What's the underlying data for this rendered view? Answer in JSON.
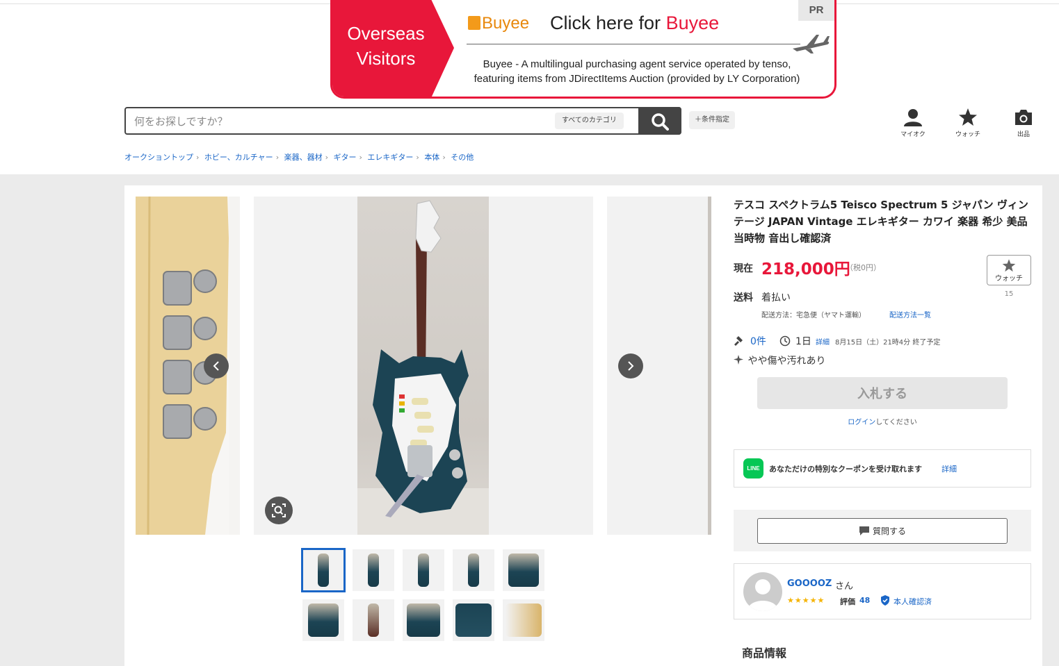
{
  "banner": {
    "left_line1": "Overseas",
    "left_line2": "Visitors",
    "pr": "PR",
    "logo": "Buyee",
    "headline_prefix": "Click here for ",
    "headline_brand": "Buyee",
    "desc_line1": "Buyee - A multilingual purchasing agent service operated by tenso,",
    "desc_line2": "featuring items from JDirectItems Auction (provided by LY Corporation)",
    "accent_color": "#e8173a"
  },
  "search": {
    "placeholder": "何をお探しですか？",
    "category": "すべてのカテゴリ",
    "conditions": "＋条件指定"
  },
  "header_nav": {
    "myauction": "マイオク",
    "watch": "ウォッチ",
    "sell": "出品"
  },
  "breadcrumb": [
    "オークショントップ",
    "ホビー、カルチャー",
    "楽器、器材",
    "ギター",
    "エレキギター",
    "本体",
    "その他"
  ],
  "item": {
    "title": "テスコ スペクトラム5 Teisco Spectrum 5 ジャパン ヴィンテージ JAPAN Vintage エレキギター カワイ 楽器 希少 美品 当時物 音出し確認済",
    "price_label": "現在",
    "price": "218,000円",
    "tax": "（税0円）",
    "watch_label": "ウォッチ",
    "watch_count": "15",
    "shipping_label": "送料",
    "shipping_value": "着払い",
    "shipping_method": "配送方法：宅急便（ヤマト運輸）",
    "shipping_link": "配送方法一覧",
    "bid_count": "0件",
    "time_left": "1日",
    "detail_link": "詳細",
    "end_time": "8月15日（土）21時4分 終了予定",
    "condition": "やや傷や汚れあり",
    "bid_button": "入札する",
    "login_link": "ログイン",
    "login_suffix": "してください"
  },
  "coupon": {
    "icon_text": "LINE",
    "text": "あなただけの特別なクーポンを受け取れます",
    "link": "詳細"
  },
  "question_button": "質問する",
  "seller": {
    "name": "GOOOOZ",
    "suffix": "さん",
    "stars": "★★★★★",
    "rating_label": "評価",
    "rating": "48",
    "verified": "本人確認済"
  },
  "section_title": "商品情報",
  "thumbnail_count": 10
}
